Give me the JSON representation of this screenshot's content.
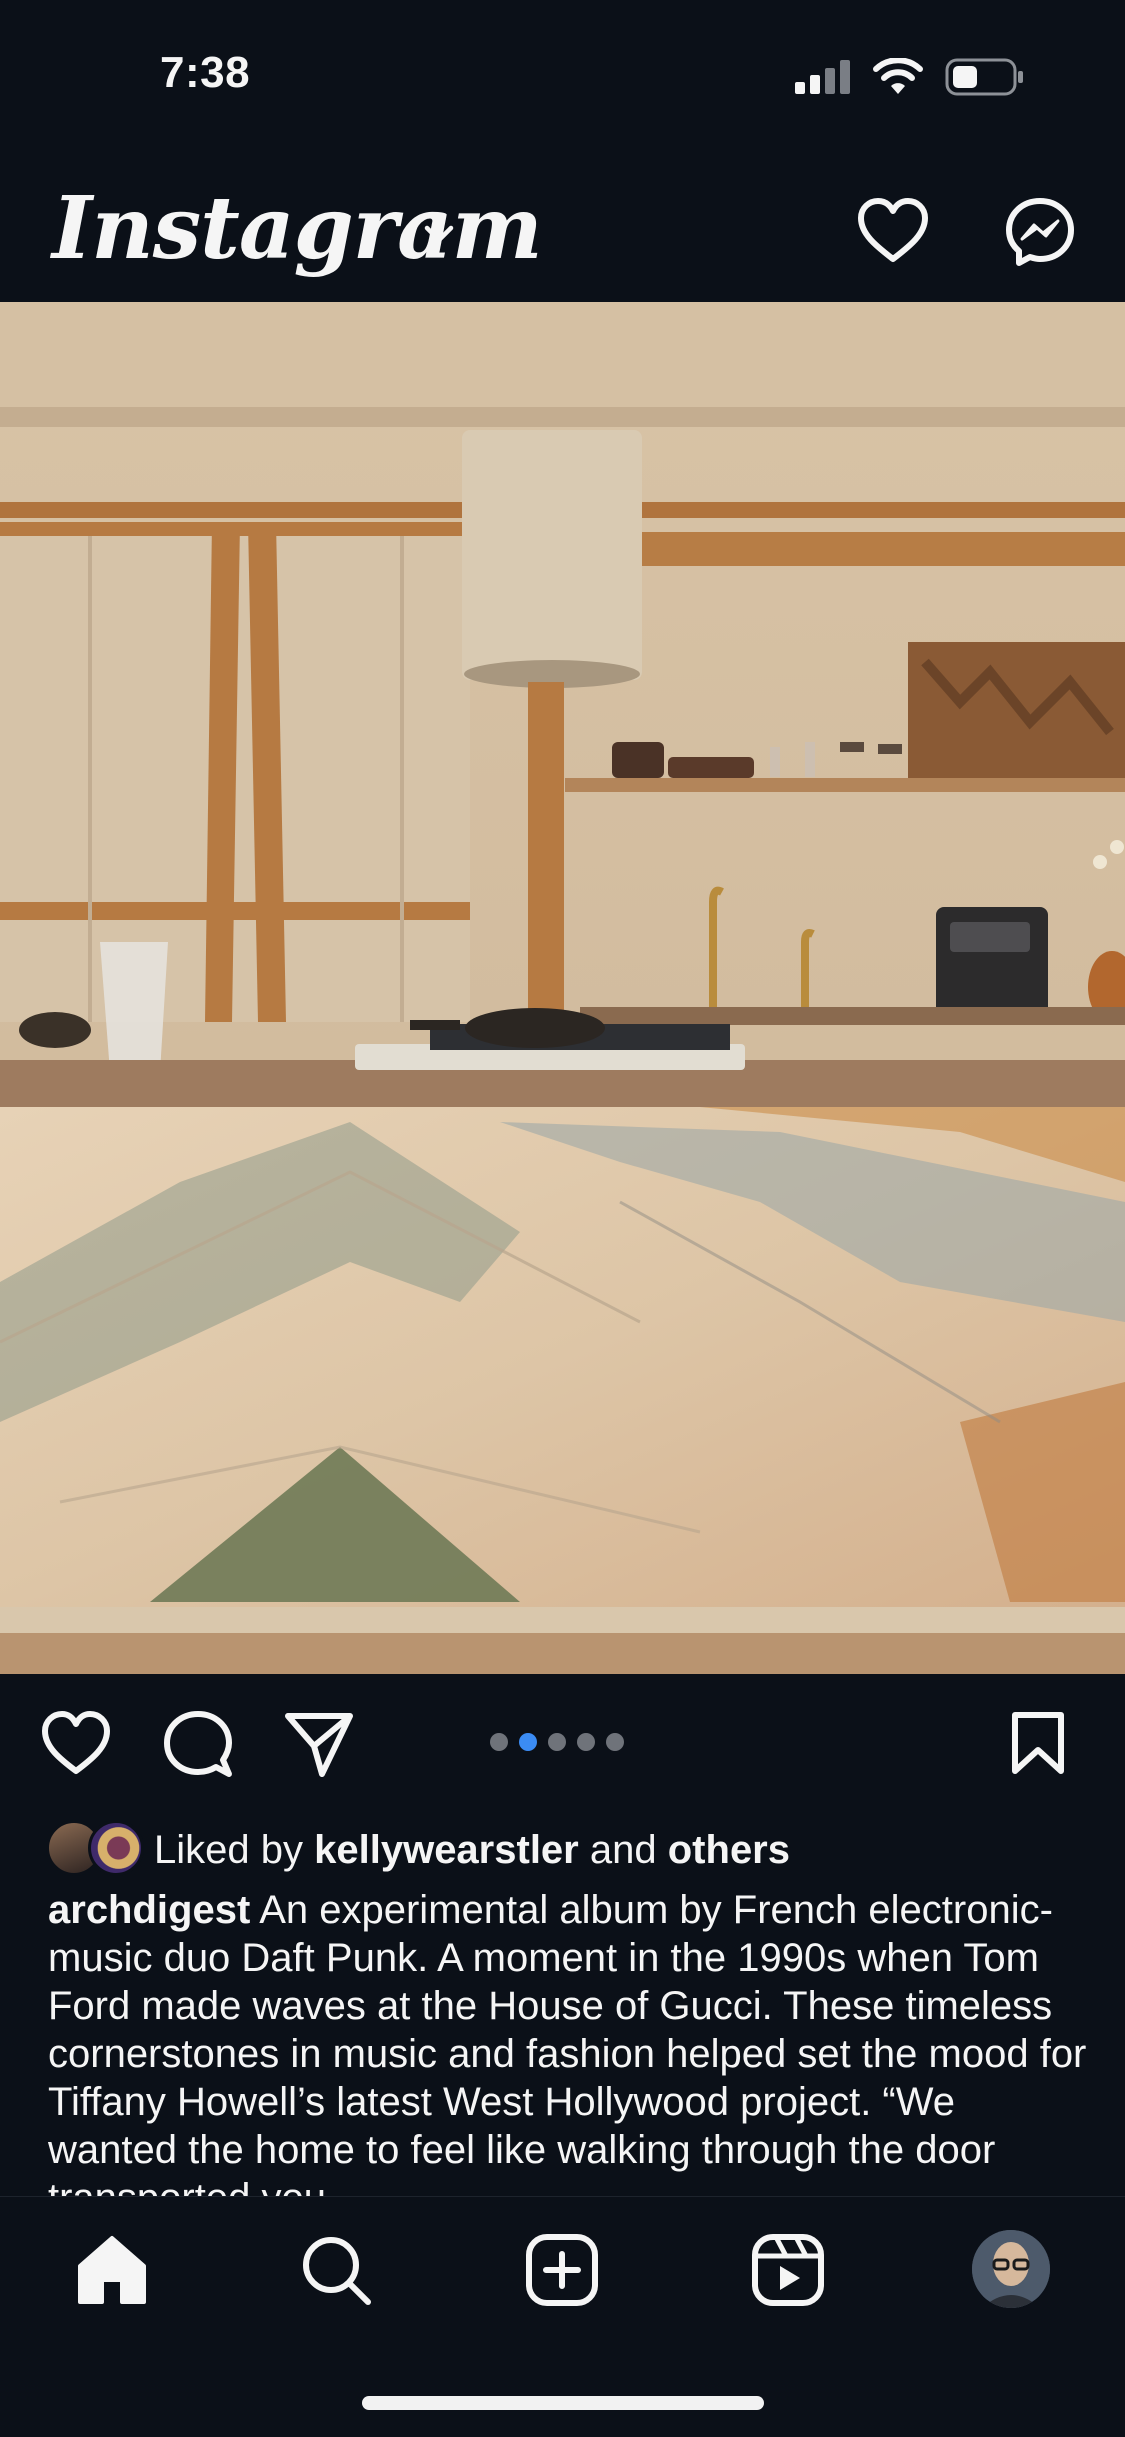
{
  "status_bar": {
    "time": "7:38"
  },
  "header": {
    "brand": "Instagram"
  },
  "carousel": {
    "total": 5,
    "active_index": 1
  },
  "likes": {
    "prefix": "Liked by",
    "user": "kellywearstler",
    "middle": "and",
    "others": "others"
  },
  "caption": {
    "username": "archdigest",
    "text": "An experimental album by French electronic-music duo Daft Punk. A moment in the 1990s when Tom Ford made waves at the House of Gucci. These timeless cornerstones in music and fashion helped set the mood for Tiffany Howell’s latest West Hollywood project. “We wanted the home to feel like walking through the door transported you"
  },
  "icons": {
    "header": [
      "chevron-down-icon",
      "heart-icon",
      "messenger-icon"
    ],
    "actions": [
      "like-icon",
      "comment-icon",
      "share-icon",
      "save-icon"
    ],
    "tabbar": [
      "home-icon",
      "search-icon",
      "create-icon",
      "reels-icon",
      "profile-avatar"
    ]
  },
  "colors": {
    "background": "#0b1018",
    "text": "#f5f5f5",
    "active_dot": "#3b8cf4",
    "inactive_dot": "#6f737a"
  }
}
